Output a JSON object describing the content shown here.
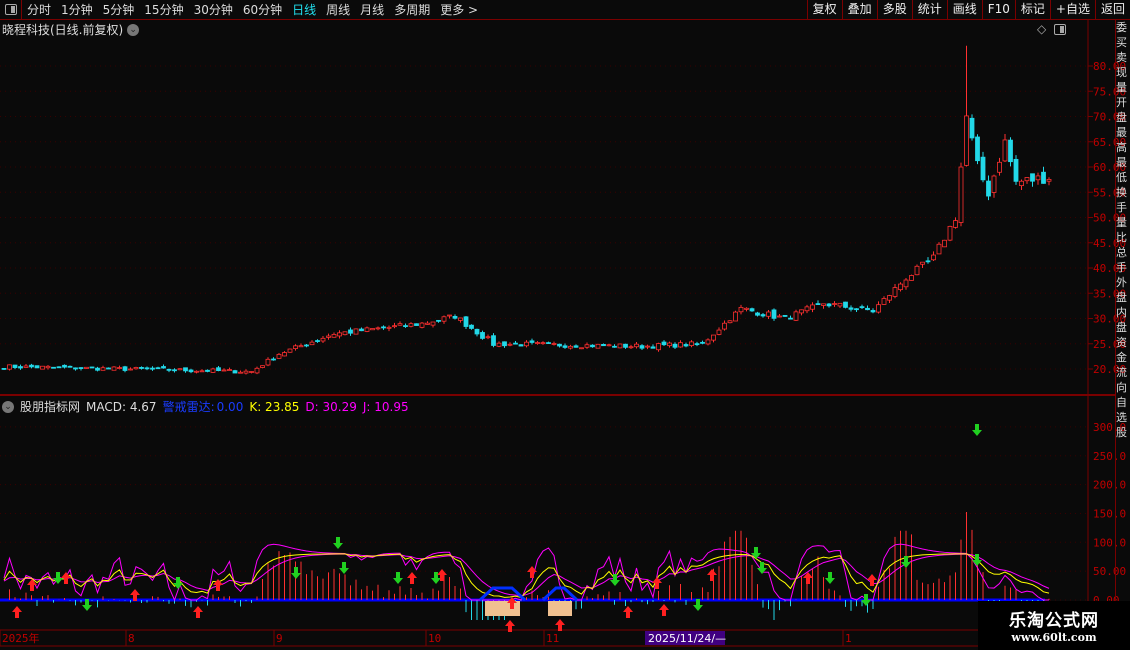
{
  "toolbar": {
    "periods": [
      "分时",
      "1分钟",
      "5分钟",
      "15分钟",
      "30分钟",
      "60分钟",
      "日线",
      "周线",
      "月线",
      "多周期",
      "更多 >"
    ],
    "active": "日线",
    "right_buttons": [
      "复权",
      "叠加",
      "多股",
      "统计",
      "画线",
      "F10",
      "标记",
      "+自选",
      "返回"
    ]
  },
  "main": {
    "title": "晓程科技(日线.前复权)",
    "price_ticks": [
      "80.00",
      "75.00",
      "70.00",
      "65.00",
      "60.00",
      "55.00",
      "50.00",
      "45.00",
      "40.00",
      "35.00",
      "30.00",
      "25.00",
      "20.00"
    ]
  },
  "indicator": {
    "name": "股朋指标网",
    "macd": "MACD: 4.67",
    "radar_label": "警戒雷达:",
    "radar_value": "0.00",
    "k": "K: 23.85",
    "d": "D: 30.29",
    "j": "J: 10.95",
    "ticks": [
      "300.0",
      "250.0",
      "200.0",
      "150.0",
      "100.0",
      "50.00",
      "0.00"
    ]
  },
  "date_axis": {
    "labels": [
      "2025年",
      "8",
      "9",
      "10",
      "11",
      "1"
    ],
    "cursor_date": "2025/11/24/—"
  },
  "right_strip": {
    "text": "委买卖现量开盘最高最低换手量比总手外盘内盘资金流向自选股"
  },
  "watermark": {
    "title": "乐淘公式网",
    "url": "www.60lt.com"
  },
  "colors": {
    "up": "#ff3030",
    "down": "#22d8e8",
    "grid": "#7a0000",
    "axis_text": "#c00000",
    "k": "#ffff00",
    "d": "#ff00ff",
    "j": "#ff00ff",
    "zero": "#0000ff"
  },
  "chart_data": {
    "type": "candlestick",
    "price_keypoints": [
      [
        0,
        20.5
      ],
      [
        45,
        19.5
      ],
      [
        50,
        23
      ],
      [
        60,
        27
      ],
      [
        76,
        29
      ],
      [
        82,
        30.5
      ],
      [
        89,
        25
      ],
      [
        116,
        24.5
      ],
      [
        127,
        25
      ],
      [
        134,
        32
      ],
      [
        142,
        30
      ],
      [
        149,
        33
      ],
      [
        158,
        31.5
      ],
      [
        164,
        38
      ],
      [
        169,
        42
      ],
      [
        173,
        50
      ],
      [
        175,
        70
      ],
      [
        177,
        60
      ],
      [
        179,
        55
      ],
      [
        182,
        65
      ],
      [
        184,
        57
      ],
      [
        190,
        58
      ]
    ],
    "ylim": [
      17,
      85
    ],
    "indicator_ylim": [
      0,
      320
    ]
  }
}
